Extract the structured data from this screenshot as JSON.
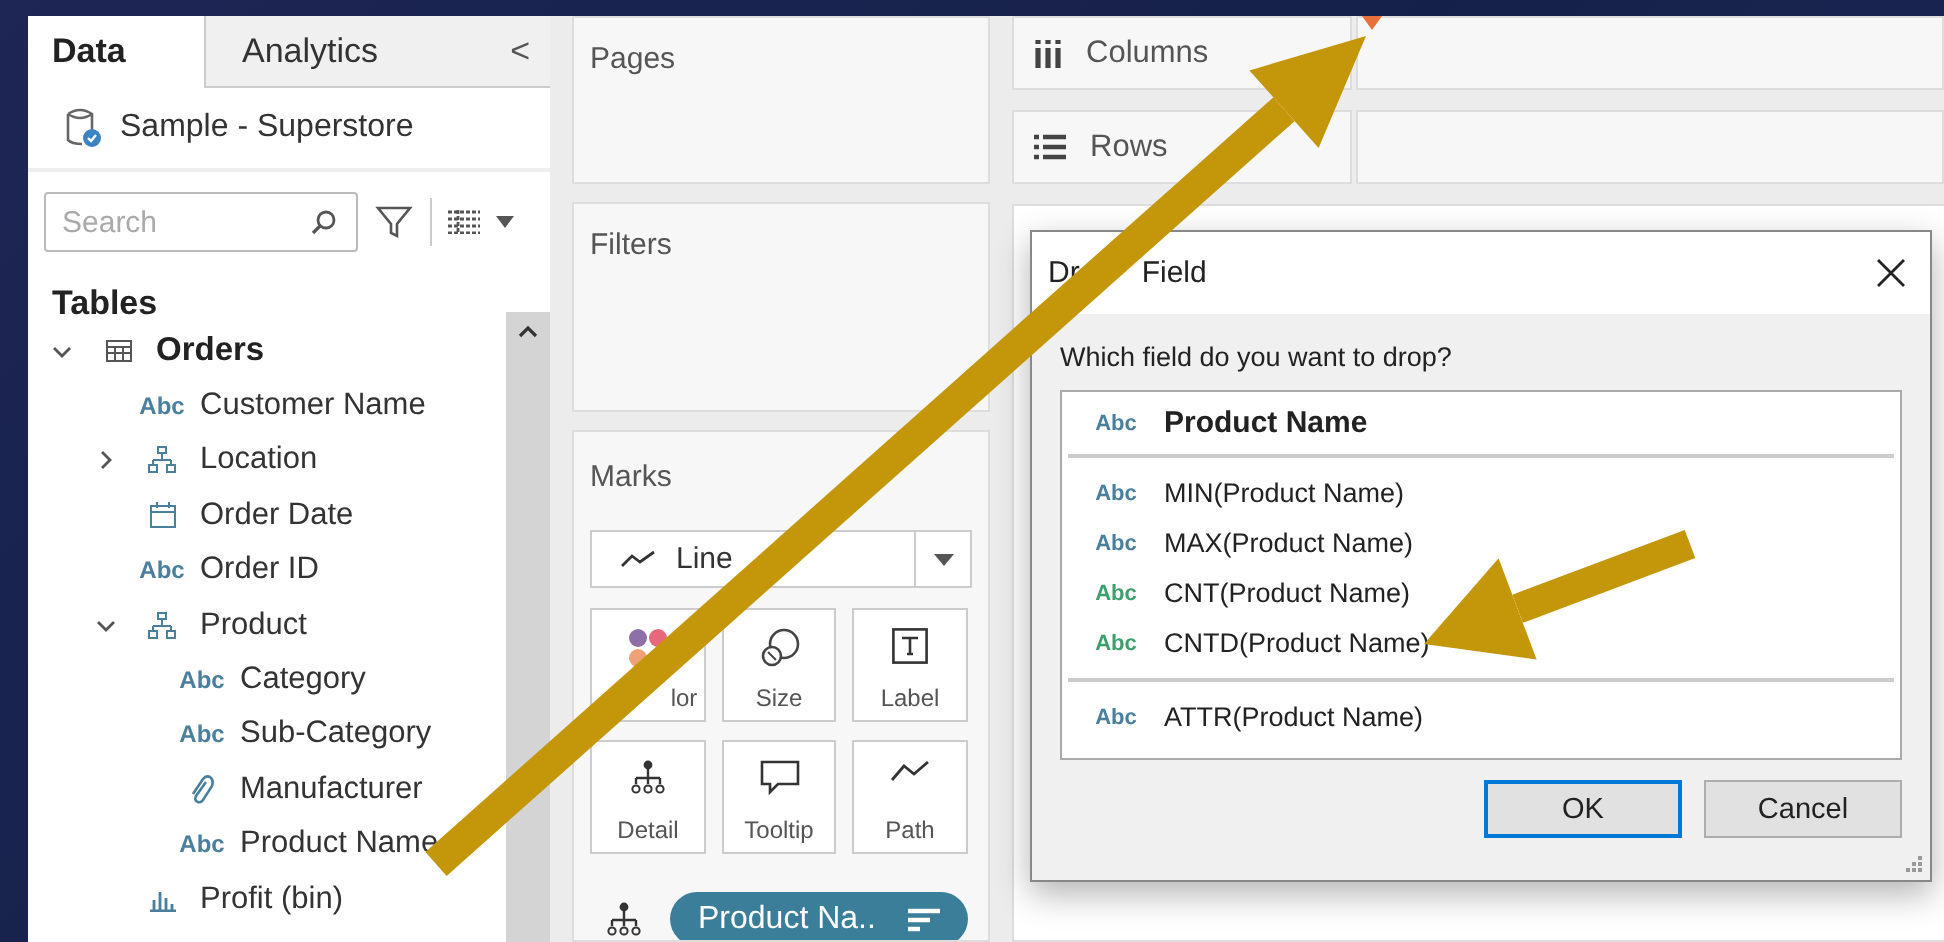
{
  "sidebar": {
    "tabs": [
      {
        "label": "Data",
        "selected": true
      },
      {
        "label": "Analytics",
        "selected": false
      }
    ],
    "collapse_icon": "<",
    "datasource": "Sample - Superstore",
    "search": {
      "placeholder": "Search"
    },
    "tables_heading": "Tables",
    "tree": [
      {
        "label": "Orders",
        "kind": "table",
        "expanded": true,
        "children": [
          {
            "label": "Customer Name",
            "kind": "text",
            "badge": "Abc"
          },
          {
            "label": "Location",
            "kind": "hierarchy",
            "expanded": false
          },
          {
            "label": "Order Date",
            "kind": "date"
          },
          {
            "label": "Order ID",
            "kind": "text",
            "badge": "Abc"
          },
          {
            "label": "Product",
            "kind": "hierarchy",
            "expanded": true,
            "children": [
              {
                "label": "Category",
                "kind": "text",
                "badge": "Abc"
              },
              {
                "label": "Sub-Category",
                "kind": "text",
                "badge": "Abc"
              },
              {
                "label": "Manufacturer",
                "kind": "group"
              },
              {
                "label": "Product Name",
                "kind": "text",
                "badge": "Abc"
              }
            ]
          },
          {
            "label": "Profit (bin)",
            "kind": "bin"
          }
        ]
      }
    ]
  },
  "shelves": {
    "pages": "Pages",
    "filters": "Filters",
    "columns": "Columns",
    "rows": "Rows"
  },
  "marks": {
    "title": "Marks",
    "mark_type": "Line",
    "cards": [
      {
        "label": "lor",
        "kind": "color"
      },
      {
        "label": "Size",
        "kind": "size"
      },
      {
        "label": "Label",
        "kind": "label"
      },
      {
        "label": "Detail",
        "kind": "detail"
      },
      {
        "label": "Tooltip",
        "kind": "tooltip"
      },
      {
        "label": "Path",
        "kind": "path"
      }
    ],
    "pill": {
      "label": "Product Na..",
      "kind": "detail"
    }
  },
  "dialog": {
    "title_parts": [
      "Dr",
      "Field"
    ],
    "prompt": "Which field do you want to drop?",
    "groups": [
      [
        {
          "badge": "Abc",
          "label": "Product Name",
          "emphasized": true,
          "color": "#4a7f9e"
        }
      ],
      [
        {
          "badge": "Abc",
          "label": "MIN(Product Name)",
          "emphasized": false,
          "color": "#4a7f9e"
        },
        {
          "badge": "Abc",
          "label": "MAX(Product Name)",
          "emphasized": false,
          "color": "#4a7f9e"
        },
        {
          "badge": "Abc",
          "label": "CNT(Product Name)",
          "emphasized": false,
          "color": "#3f9e6e"
        },
        {
          "badge": "Abc",
          "label": "CNTD(Product Name)",
          "emphasized": false,
          "color": "#3f9e6e"
        }
      ],
      [
        {
          "badge": "Abc",
          "label": "ATTR(Product Name)",
          "emphasized": false,
          "color": "#4a7f9e"
        }
      ]
    ],
    "buttons": [
      {
        "label": "OK",
        "focused": true
      },
      {
        "label": "Cancel",
        "focused": false
      }
    ]
  }
}
